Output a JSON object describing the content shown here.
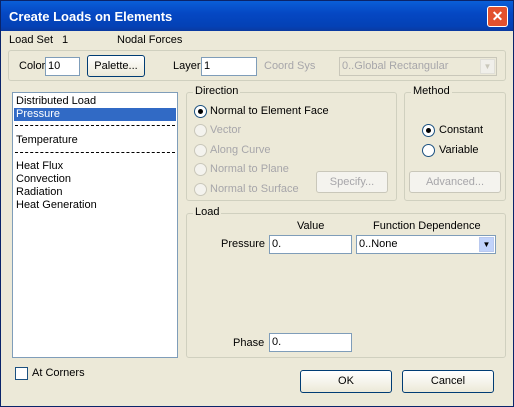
{
  "window": {
    "title": "Create Loads on Elements",
    "close_glyph": "✕"
  },
  "header": {
    "load_set_label": "Load Set",
    "load_set_value": "1",
    "load_type": "Nodal Forces"
  },
  "toolbar": {
    "color_label": "Color",
    "color_value": "10",
    "palette_button": "Palette...",
    "layer_label": "Layer",
    "layer_value": "1",
    "coord_sys_label": "Coord Sys",
    "coord_sys_value": "0..Global Rectangular"
  },
  "load_list": {
    "items": [
      {
        "label": "Distributed Load",
        "selected": false
      },
      {
        "label": "Pressure",
        "selected": true
      },
      {
        "label": "Temperature",
        "selected": false
      },
      {
        "label": "Heat Flux",
        "selected": false
      },
      {
        "label": "Convection",
        "selected": false
      },
      {
        "label": "Radiation",
        "selected": false
      },
      {
        "label": "Heat Generation",
        "selected": false
      }
    ]
  },
  "direction": {
    "title": "Direction",
    "options": [
      {
        "label": "Normal to Element Face",
        "selected": true,
        "enabled": true
      },
      {
        "label": "Vector",
        "selected": false,
        "enabled": false
      },
      {
        "label": "Along Curve",
        "selected": false,
        "enabled": false
      },
      {
        "label": "Normal to Plane",
        "selected": false,
        "enabled": false
      },
      {
        "label": "Normal to Surface",
        "selected": false,
        "enabled": false
      }
    ],
    "specify_button": "Specify..."
  },
  "method": {
    "title": "Method",
    "options": [
      {
        "label": "Constant",
        "selected": true
      },
      {
        "label": "Variable",
        "selected": false
      }
    ],
    "advanced_button": "Advanced..."
  },
  "load": {
    "title": "Load",
    "value_header": "Value",
    "function_header": "Function Dependence",
    "pressure_label": "Pressure",
    "pressure_value": "0.",
    "function_value": "0..None",
    "phase_label": "Phase",
    "phase_value": "0."
  },
  "footer": {
    "at_corners_label": "At Corners",
    "at_corners_checked": false,
    "ok_button": "OK",
    "cancel_button": "Cancel"
  },
  "icons": {
    "dropdown_arrow": "▼"
  },
  "colors": {
    "title_bar": "#0548c4",
    "selection": "#316ac5",
    "dialog_bg": "#ece9d8"
  }
}
